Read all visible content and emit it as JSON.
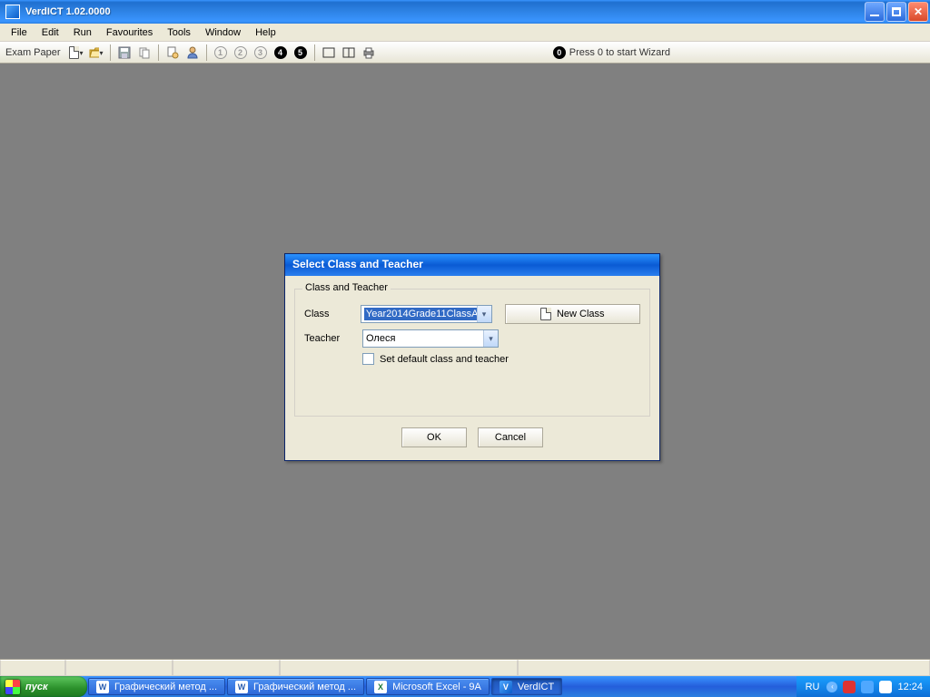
{
  "window": {
    "title": "VerdICT 1.02.0000"
  },
  "menu": {
    "items": [
      "File",
      "Edit",
      "Run",
      "Favourites",
      "Tools",
      "Window",
      "Help"
    ]
  },
  "toolbar": {
    "label": "Exam Paper",
    "wizard_hint": "Press 0 to start Wizard"
  },
  "dialog": {
    "title": "Select Class and Teacher",
    "group_legend": "Class and Teacher",
    "class_label": "Class",
    "class_value": "Year2014Grade11ClassA",
    "teacher_label": "Teacher",
    "teacher_value": "Олеся",
    "new_class_label": "New Class",
    "checkbox_label": "Set default class and teacher",
    "ok": "OK",
    "cancel": "Cancel"
  },
  "taskbar": {
    "start": "пуск",
    "tasks": [
      {
        "label": "Графический метод ...",
        "kind": "word"
      },
      {
        "label": "Графический метод ...",
        "kind": "word"
      },
      {
        "label": "Microsoft Excel - 9A",
        "kind": "excel"
      },
      {
        "label": "VerdICT",
        "kind": "verdict"
      }
    ],
    "lang": "RU",
    "clock": "12:24"
  }
}
